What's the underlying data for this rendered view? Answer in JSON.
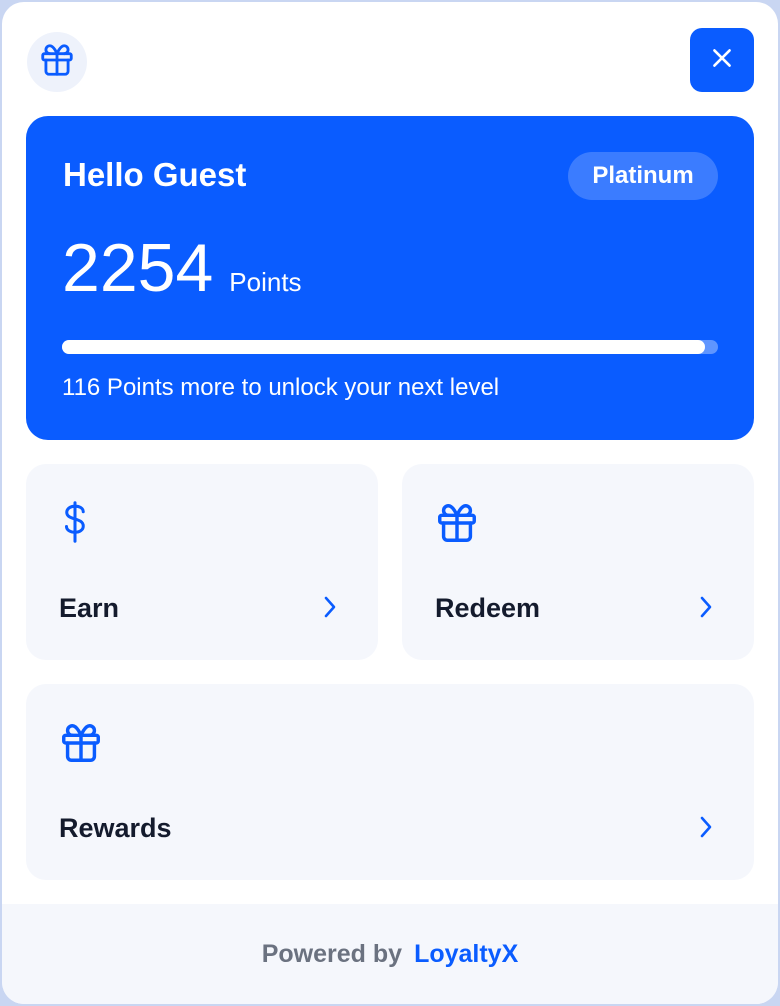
{
  "colors": {
    "accent": "#0a5cff",
    "card_bg": "#f5f7fc",
    "text_dark": "#141b2d",
    "muted": "#6b7280"
  },
  "header": {
    "logo_icon": "gift-icon",
    "close_icon": "close-icon"
  },
  "hero": {
    "title": "Hello Guest",
    "tier": "Platinum",
    "points": "2254",
    "points_unit": "Points",
    "progress_fraction": 0.98,
    "progress_text": "116 Points more to unlock your next level"
  },
  "cards": {
    "earn": {
      "label": "Earn",
      "icon": "dollar-icon"
    },
    "redeem": {
      "label": "Redeem",
      "icon": "gift-icon"
    },
    "rewards": {
      "label": "Rewards",
      "icon": "gift-icon"
    }
  },
  "footer": {
    "powered_by": "Powered by",
    "brand": "LoyaltyX"
  }
}
